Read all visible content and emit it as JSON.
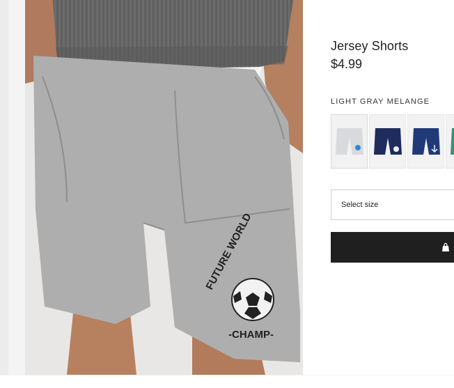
{
  "product": {
    "title": "Jersey Shorts",
    "price": "$4.99",
    "color_name": "LIGHT GRAY MELANGE",
    "print_text_top": "FUTURE WORLD",
    "print_text_bottom": "-CHAMP-"
  },
  "swatches": [
    {
      "color": "#d9dbdd",
      "label": "light gray melange"
    },
    {
      "color": "#1f2c5c",
      "label": "dark blue soccer"
    },
    {
      "color": "#203a78",
      "label": "dark blue anchor"
    },
    {
      "color": "#3a8f76",
      "label": "green patterned"
    }
  ],
  "size_select": {
    "placeholder": "Select size"
  },
  "add_to_bag": {
    "icon": "shopping-bag-icon"
  },
  "colors": {
    "button_bg": "#1f1f1f",
    "accent_text": "#222222"
  }
}
